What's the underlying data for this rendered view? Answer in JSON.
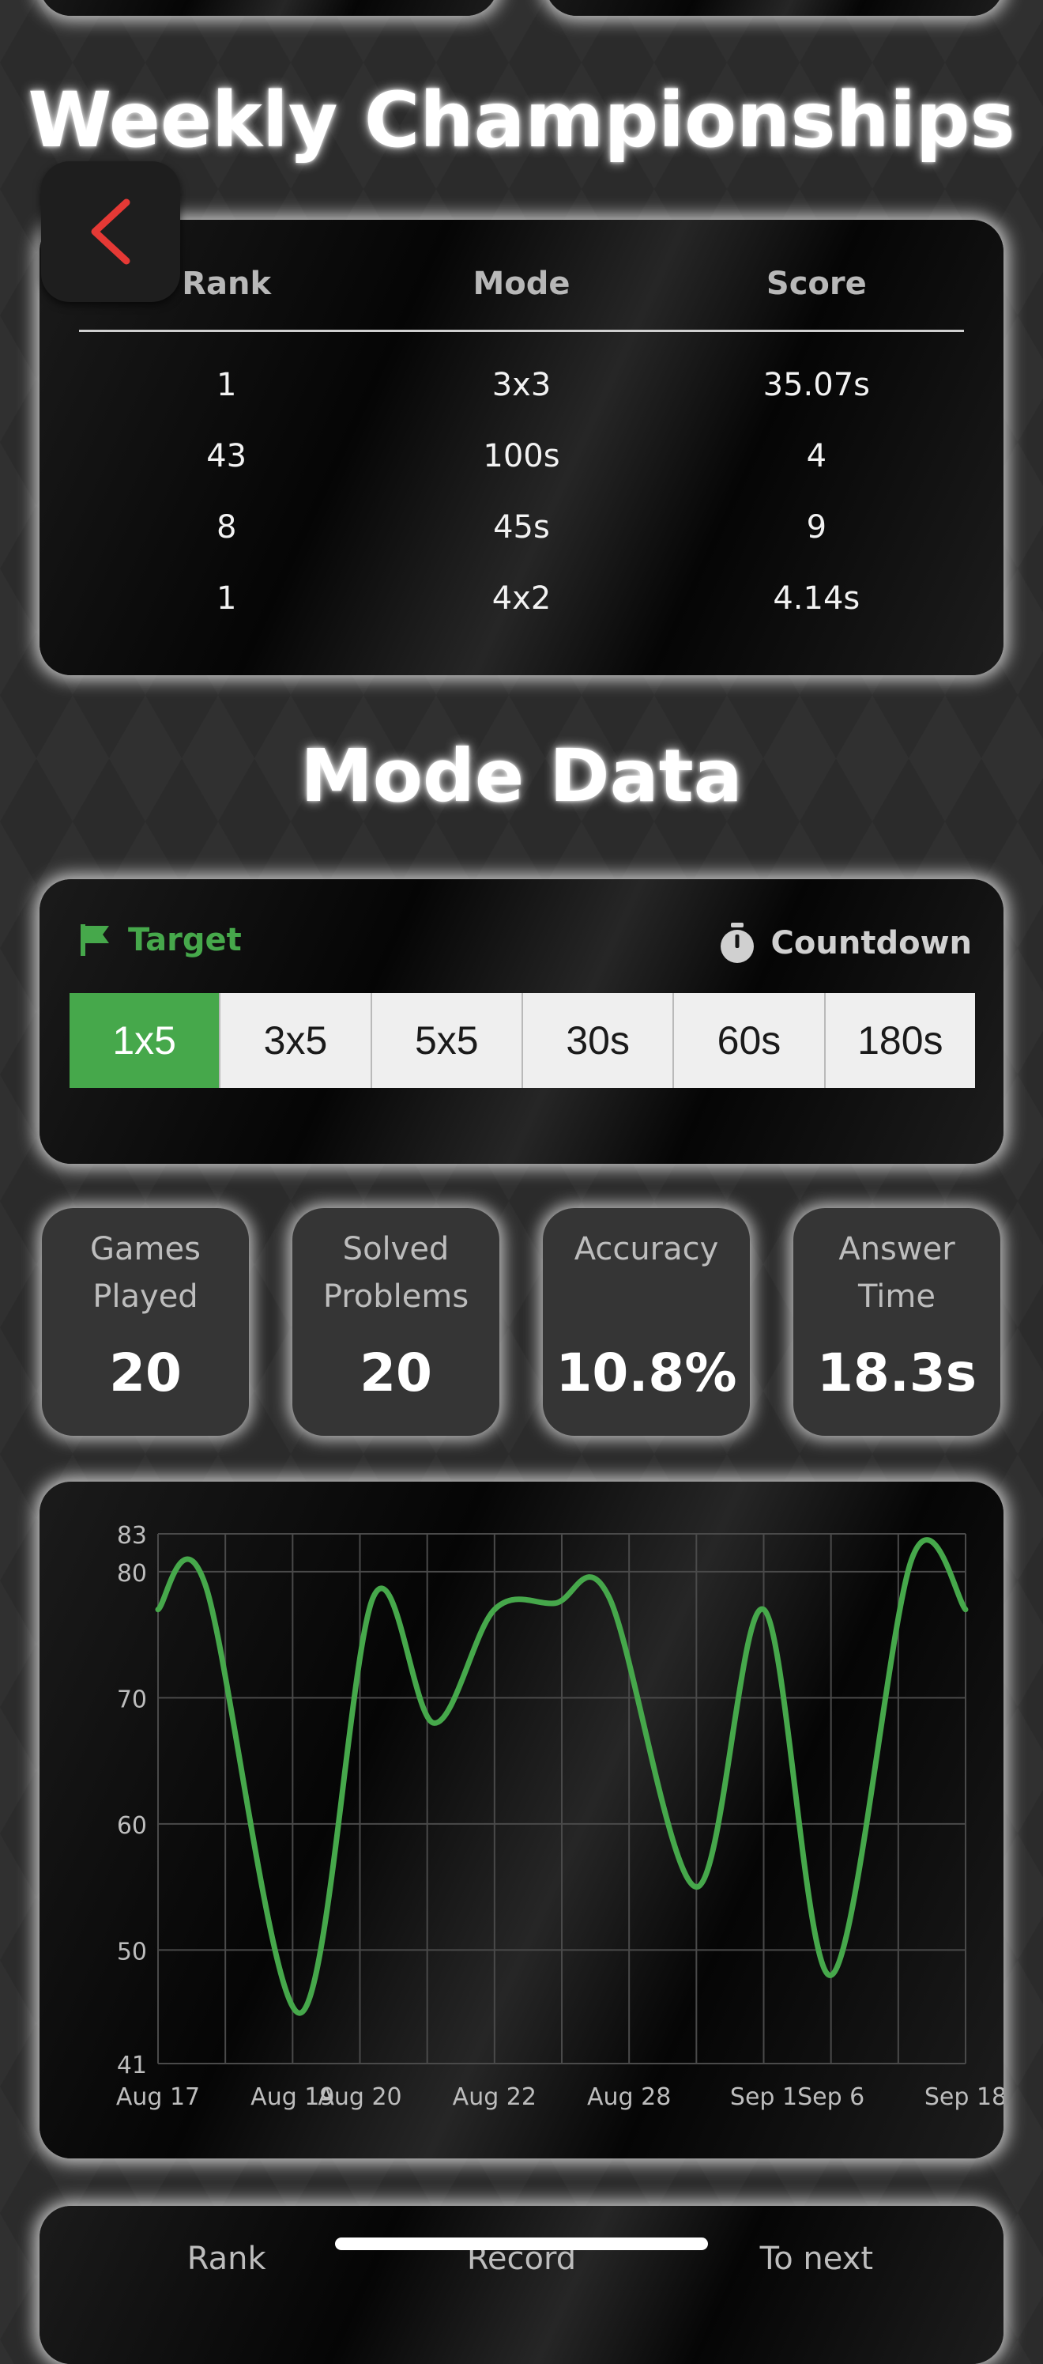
{
  "colors": {
    "accent_green": "#46a84b",
    "back_arrow": "#e53935"
  },
  "championships": {
    "title": "Weekly Championships",
    "columns": [
      "Rank",
      "Mode",
      "Score"
    ],
    "rows": [
      [
        "1",
        "3x3",
        "35.07s"
      ],
      [
        "43",
        "100s",
        "4"
      ],
      [
        "8",
        "45s",
        "9"
      ],
      [
        "1",
        "4x2",
        "4.14s"
      ]
    ]
  },
  "mode_data": {
    "title": "Mode Data",
    "target_label": "Target",
    "target_icon": "flag-icon",
    "countdown_label": "Countdown",
    "countdown_icon": "stopwatch-icon",
    "options": [
      "1x5",
      "3x5",
      "5x5",
      "30s",
      "60s",
      "180s"
    ],
    "selected": "1x5"
  },
  "stats": [
    {
      "label_line1": "Games",
      "label_line2": "Played",
      "value": "20"
    },
    {
      "label_line1": "Solved",
      "label_line2": "Problems",
      "value": "20"
    },
    {
      "label_line1": "Accuracy",
      "label_line2": "",
      "value": "10.8%"
    },
    {
      "label_line1": "Answer",
      "label_line2": "Time",
      "value": "18.3s"
    }
  ],
  "chart_data": {
    "type": "line",
    "x": [
      "Aug 17",
      "Aug 19",
      "Aug 20",
      "Aug 22",
      "Aug 28",
      "Sep 1",
      "Sep 6",
      "Sep 18"
    ],
    "x_positions": [
      0,
      2,
      3,
      5,
      7,
      9,
      10,
      12
    ],
    "y_ticks": [
      41,
      50,
      60,
      70,
      80,
      83
    ],
    "ylim": [
      41,
      83
    ],
    "grid": true,
    "line_color": "#46a84b",
    "series": [
      {
        "values": [
          {
            "x": 0,
            "y": 77
          },
          {
            "x": 0.7,
            "y": 79
          },
          {
            "x": 2.1,
            "y": 45
          },
          {
            "x": 3.2,
            "y": 78
          },
          {
            "x": 4.1,
            "y": 68
          },
          {
            "x": 5.0,
            "y": 77
          },
          {
            "x": 5.9,
            "y": 77.5
          },
          {
            "x": 6.7,
            "y": 78
          },
          {
            "x": 8.0,
            "y": 55
          },
          {
            "x": 9.0,
            "y": 77
          },
          {
            "x": 10.0,
            "y": 48
          },
          {
            "x": 11.2,
            "y": 81
          },
          {
            "x": 12,
            "y": 77
          }
        ]
      }
    ]
  },
  "bottom_table": {
    "columns": [
      "Rank",
      "Record",
      "To next"
    ]
  }
}
